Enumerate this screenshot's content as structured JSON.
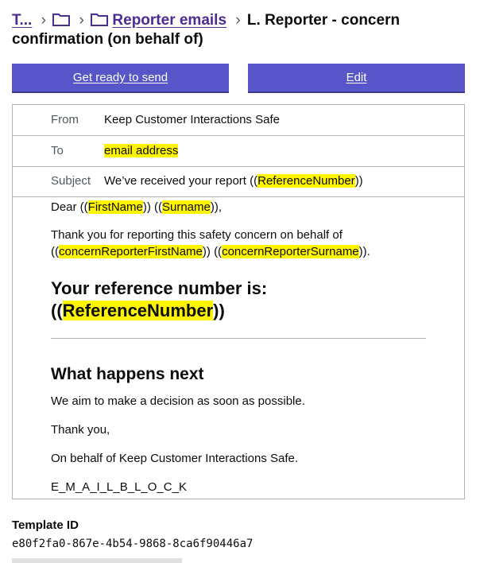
{
  "breadcrumb": {
    "root_label": "T...",
    "folder_label": "Reporter emails",
    "current_title": "L. Reporter - concern confirmation (on behalf of)"
  },
  "actions": {
    "send_label": "Get ready to send",
    "edit_label": "Edit"
  },
  "email": {
    "from_label": "From",
    "from_value": "Keep Customer Interactions Safe",
    "to_label": "To",
    "to_value": "email address",
    "subject_label": "Subject",
    "subject_prefix": "We’ve received your report ((",
    "subject_placeholder": "ReferenceNumber",
    "subject_suffix": "))",
    "body": {
      "dear_prefix": "Dear ((",
      "first_name": "FirstName",
      "mid": ")) ((",
      "surname": "Surname",
      "dear_suffix": ")),",
      "thanks_text": "Thank you for reporting this safety concern on behalf of",
      "open_paren": "((",
      "reporter_first": "concernReporterFirstName",
      "reporter_mid": ")) ((",
      "reporter_surname": "concernReporterSurname",
      "reporter_suffix": ")).",
      "ref_heading_prefix": "Your reference number is: ((",
      "ref_placeholder": "ReferenceNumber",
      "ref_heading_suffix": "))",
      "next_heading": "What happens next",
      "decision_text": "We aim to make a decision as soon as possible.",
      "thank_you": "Thank you,",
      "behalf_text": "On behalf of Keep Customer Interactions Safe.",
      "email_block": "E_M_A_I_L_B_L_O_C_K"
    }
  },
  "template": {
    "id_label": "Template ID",
    "id_value": "e80f2fa0-867e-4b54-9868-8ca6f90446a7"
  },
  "colors": {
    "button": "#5755c7",
    "link": "#4c2c92",
    "highlight": "#fff500",
    "border": "#b1b4b6"
  }
}
